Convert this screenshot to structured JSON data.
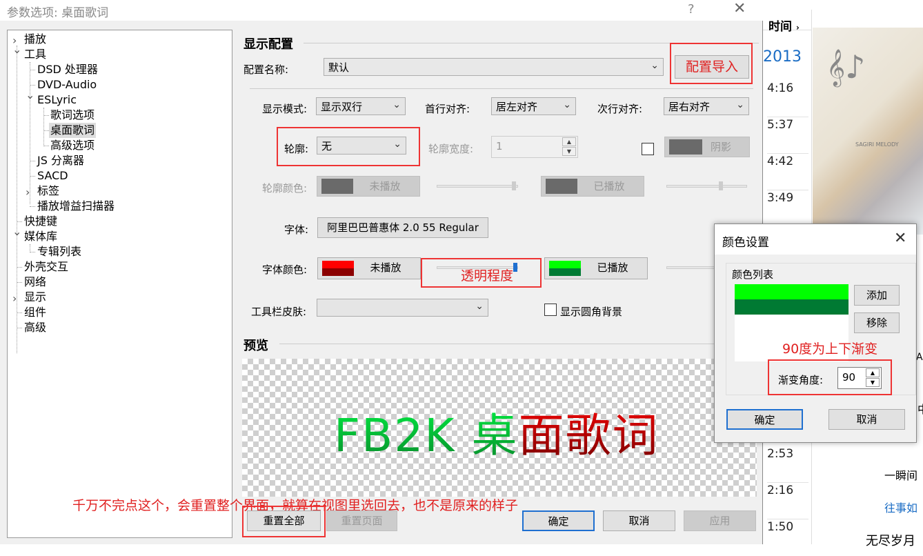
{
  "background_app": {
    "header": "时间",
    "year": "2013",
    "times": [
      "4:16",
      "5:37",
      "4:42",
      "3:49",
      "2:53",
      "2:16",
      "1:50"
    ],
    "side_text": [
      "一瞬间",
      "往事如",
      "无尽岁月",
      "中",
      "AC"
    ],
    "image_text": "SAGIRI MELODY"
  },
  "dialog": {
    "title": "参数选项: 桌面歌词",
    "help": "?",
    "close": "✕"
  },
  "tree": [
    {
      "label": "播放",
      "exp": "right"
    },
    {
      "label": "工具",
      "exp": "down"
    },
    {
      "label": "DSD 处理器"
    },
    {
      "label": "DVD-Audio"
    },
    {
      "label": "ESLyric",
      "exp": "down"
    },
    {
      "label": "歌词选项"
    },
    {
      "label": "桌面歌词",
      "selected": true
    },
    {
      "label": "高级选项"
    },
    {
      "label": "JS 分离器"
    },
    {
      "label": "SACD"
    },
    {
      "label": "标签",
      "exp": "right"
    },
    {
      "label": "播放增益扫描器"
    },
    {
      "label": "快捷键"
    },
    {
      "label": "媒体库",
      "exp": "down"
    },
    {
      "label": "专辑列表"
    },
    {
      "label": "外壳交互"
    },
    {
      "label": "网络"
    },
    {
      "label": "显示",
      "exp": "right"
    },
    {
      "label": "组件"
    },
    {
      "label": "高级"
    }
  ],
  "panel": {
    "section_title": "显示配置",
    "config_name_label": "配置名称:",
    "config_name_value": "默认",
    "import_button": "配置导入",
    "display_mode_label": "显示模式:",
    "display_mode_value": "显示双行",
    "first_align_label": "首行对齐:",
    "first_align_value": "居左对齐",
    "second_align_label": "次行对齐:",
    "second_align_value": "居右对齐",
    "outline_label": "轮廓:",
    "outline_value": "无",
    "outline_width_label": "轮廓宽度:",
    "outline_width_value": "1",
    "shadow_label": "阴影",
    "outline_color_label": "轮廓颜色:",
    "unplayed": "未播放",
    "played": "已播放",
    "font_label": "字体:",
    "font_value": "阿里巴巴普惠体 2.0 55 Regular",
    "font_color_label": "字体颜色:",
    "skin_label": "工具栏皮肤:",
    "skin_value": "",
    "round_bg_label": "显示圆角背景",
    "preview_title": "预览",
    "preview_text_green": "FB2K 桌",
    "preview_text_red": "面歌词",
    "reset_all": "重置全部",
    "reset_page": "重置页面",
    "ok": "确定",
    "cancel": "取消",
    "apply": "应用"
  },
  "annotations": {
    "import": "配置导入",
    "transparency": "透明程度",
    "gradient": "90度为上下渐变",
    "warning": "千万不完点这个，会重置整个界面，就算在视图里选回去，也不是原来的样子"
  },
  "color_dialog": {
    "title": "颜色设置",
    "list_label": "颜色列表",
    "add": "添加",
    "remove": "移除",
    "angle_label": "渐变角度:",
    "angle_value": "90",
    "ok": "确定",
    "cancel": "取消"
  },
  "colors": {
    "red_highlight": "#e33333",
    "unplayed_top": "#ff0000",
    "unplayed_bottom": "#8b0000",
    "played_top": "#00ff00",
    "played_bottom": "#007a33",
    "accent": "#0066cc"
  }
}
